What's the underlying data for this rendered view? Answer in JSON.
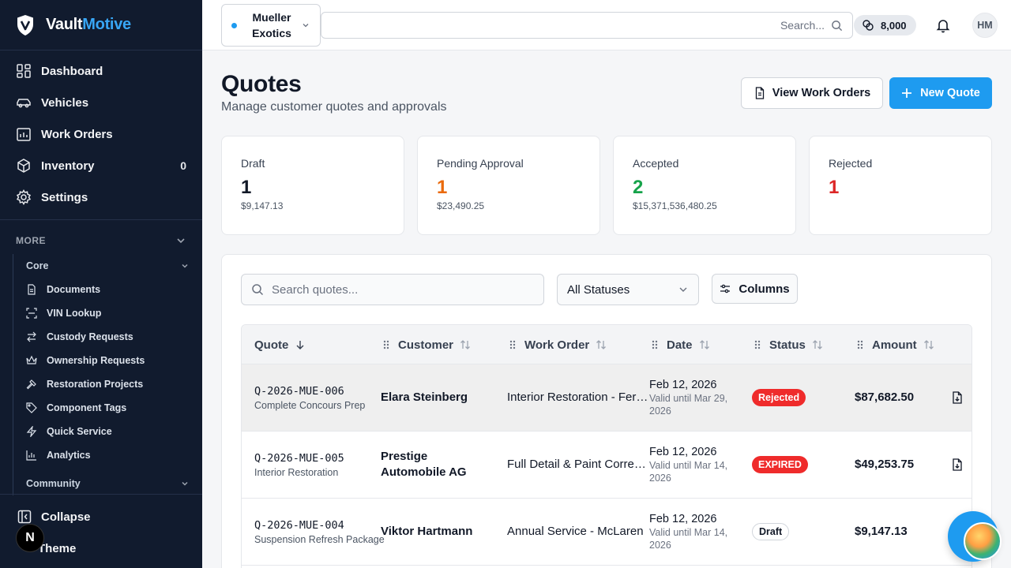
{
  "brand": {
    "name_part1": "Vault",
    "name_part2": "Motive"
  },
  "sidebar": {
    "items": [
      {
        "label": "Dashboard",
        "icon": "dashboard-icon"
      },
      {
        "label": "Vehicles",
        "icon": "car-icon"
      },
      {
        "label": "Work Orders",
        "icon": "work-orders-icon"
      },
      {
        "label": "Inventory",
        "icon": "box-icon",
        "count": "0"
      },
      {
        "label": "Settings",
        "icon": "gear-icon"
      }
    ],
    "more_label": "MORE",
    "core_label": "Core",
    "core_items": [
      {
        "label": "Documents",
        "icon": "document-icon"
      },
      {
        "label": "VIN Lookup",
        "icon": "scan-icon"
      },
      {
        "label": "Custody Requests",
        "icon": "transfer-icon"
      },
      {
        "label": "Ownership Requests",
        "icon": "crown-icon"
      },
      {
        "label": "Restoration Projects",
        "icon": "hammer-icon"
      },
      {
        "label": "Component Tags",
        "icon": "tag-icon"
      },
      {
        "label": "Quick Service",
        "icon": "lightning-icon"
      },
      {
        "label": "Analytics",
        "icon": "chart-icon"
      }
    ],
    "community_label": "Community",
    "collapse_label": "Collapse",
    "theme_label": "Theme",
    "n_badge": "N"
  },
  "topbar": {
    "shop_name": "Mueller Exotics",
    "search_placeholder": "Search...",
    "credits": "8,000",
    "avatar_initials": "HM"
  },
  "page": {
    "title": "Quotes",
    "subtitle": "Manage customer quotes and approvals",
    "view_work_orders_label": "View Work Orders",
    "new_quote_label": "New Quote"
  },
  "stats": [
    {
      "label": "Draft",
      "value": "1",
      "amount": "$9,147.13",
      "color": "#111827"
    },
    {
      "label": "Pending Approval",
      "value": "1",
      "amount": "$23,490.25",
      "color": "#ea6a0c"
    },
    {
      "label": "Accepted",
      "value": "2",
      "amount": "$15,371,536,480.25",
      "color": "#16a34a"
    },
    {
      "label": "Rejected",
      "value": "1",
      "amount": "",
      "color": "#dc2626"
    }
  ],
  "filters": {
    "search_placeholder": "Search quotes...",
    "status_value": "All Statuses",
    "columns_label": "Columns"
  },
  "table": {
    "headers": {
      "quote": "Quote",
      "customer": "Customer",
      "work_order": "Work Order",
      "date": "Date",
      "status": "Status",
      "amount": "Amount"
    },
    "rows": [
      {
        "id": "Q-2026-MUE-006",
        "desc": "Complete Concours Prep",
        "customer": "Elara Steinberg",
        "work_order": "Interior Restoration - Ferrari",
        "date": "Feb 12, 2026",
        "valid": "Valid until Mar 29, 2026",
        "status": "Rejected",
        "amount": "$87,682.50"
      },
      {
        "id": "Q-2026-MUE-005",
        "desc": "Interior Restoration",
        "customer": "Prestige Automobile AG",
        "work_order": "Full Detail & Paint Correction",
        "date": "Feb 12, 2026",
        "valid": "Valid until Mar 14, 2026",
        "status": "EXPIRED",
        "amount": "$49,253.75"
      },
      {
        "id": "Q-2026-MUE-004",
        "desc": "Suspension Refresh Package",
        "customer": "Viktor Hartmann",
        "work_order": "Annual Service - McLaren",
        "date": "Feb 12, 2026",
        "valid": "Valid until Mar 14, 2026",
        "status": "Draft",
        "amount": "$9,147.13"
      }
    ]
  }
}
